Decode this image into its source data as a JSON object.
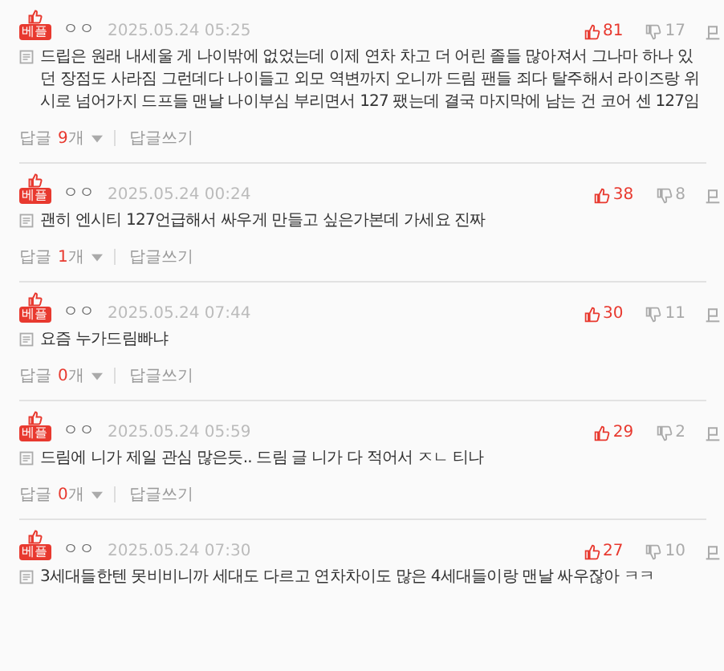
{
  "comments": [
    {
      "badge": "베플",
      "author": "ㅇㅇ",
      "date": "2025.05.24 05:25",
      "likes": "81",
      "dislikes": "17",
      "text": "드립은 원래 내세울 게 나이밖에 없었는데 이제 연차 차고 더 어린 졸들 많아져서 그나마 하나 있던 장점도 사라짐 그런데다 나이들고 외모 역변까지 오니까 드림 팬들 죄다 탈주해서 라이즈랑 위시로 넘어가지 드프들 맨날 나이부심 부리면서 127 팼는데 결국 마지막에 남는 건 코어 센 127임",
      "reply": {
        "label": "답글",
        "count": "9",
        "unit": "개",
        "write": "답글쓰기"
      }
    },
    {
      "badge": "베플",
      "author": "ㅇㅇ",
      "date": "2025.05.24 00:24",
      "likes": "38",
      "dislikes": "8",
      "text": "괜히 엔시티 127언급해서 싸우게 만들고 싶은가본데 가세요 진짜",
      "reply": {
        "label": "답글",
        "count": "1",
        "unit": "개",
        "write": "답글쓰기"
      }
    },
    {
      "badge": "베플",
      "author": "ㅇㅇ",
      "date": "2025.05.24 07:44",
      "likes": "30",
      "dislikes": "11",
      "text": "요즘 누가드림빠냐",
      "reply": {
        "label": "답글",
        "count": "0",
        "unit": "개",
        "write": "답글쓰기"
      }
    },
    {
      "badge": "베플",
      "author": "ㅇㅇ",
      "date": "2025.05.24 05:59",
      "likes": "29",
      "dislikes": "2",
      "text": "드림에 니가 제일 관심 많은듯.. 드림 글 니가 다 적어서 ㅈㄴ 티나",
      "reply": {
        "label": "답글",
        "count": "0",
        "unit": "개",
        "write": "답글쓰기"
      }
    },
    {
      "badge": "베플",
      "author": "ㅇㅇ",
      "date": "2025.05.24 07:30",
      "likes": "27",
      "dislikes": "10",
      "text": "3세대들한텐 못비비니까 세대도 다르고 연차차이도 많은 4세대들이랑 맨날 싸우잖아 ㅋㅋ"
    }
  ]
}
